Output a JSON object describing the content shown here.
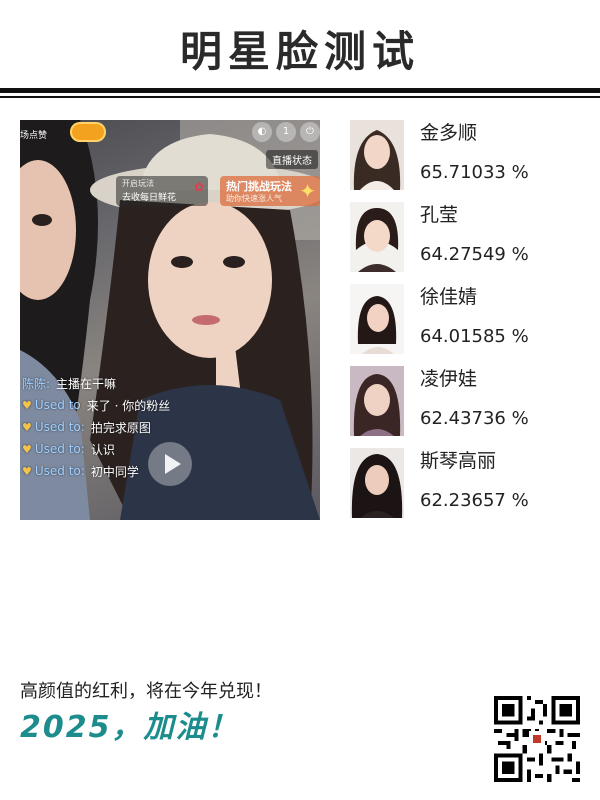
{
  "header": {
    "title": "明星脸测试"
  },
  "photo": {
    "top_left_text": "场点赞",
    "top_right_icon_text": "1",
    "live_status": "直播状态",
    "flower_card": {
      "line1": "开启玩法",
      "line2": "去收每日鲜花"
    },
    "challenge_card": {
      "line1": "热门挑战玩法",
      "line2": "助你快速涨人气"
    },
    "chat": [
      {
        "user": "陈陈:",
        "text": "主播在干嘛",
        "heart": false
      },
      {
        "user": "Used to",
        "text": "来了 · 你的粉丝",
        "heart": true
      },
      {
        "user": "Used to:",
        "text": "拍完求原图",
        "heart": true
      },
      {
        "user": "Used to:",
        "text": "认识",
        "heart": true
      },
      {
        "user": "Used to:",
        "text": "初中同学",
        "heart": true
      }
    ]
  },
  "results": [
    {
      "name": "金多顺",
      "score": "65.71033 %"
    },
    {
      "name": "孔莹",
      "score": "64.27549 %"
    },
    {
      "name": "徐佳婧",
      "score": "64.01585 %"
    },
    {
      "name": "凌伊娃",
      "score": "62.43736 %"
    },
    {
      "name": "斯琴高丽",
      "score": "62.23657 %"
    }
  ],
  "footer": {
    "line1": "高颜值的红利，将在今年兑现！",
    "line2": "2025，加油！"
  },
  "colors": {
    "accent_teal": "#1c8c8c",
    "rule": "#111111"
  }
}
